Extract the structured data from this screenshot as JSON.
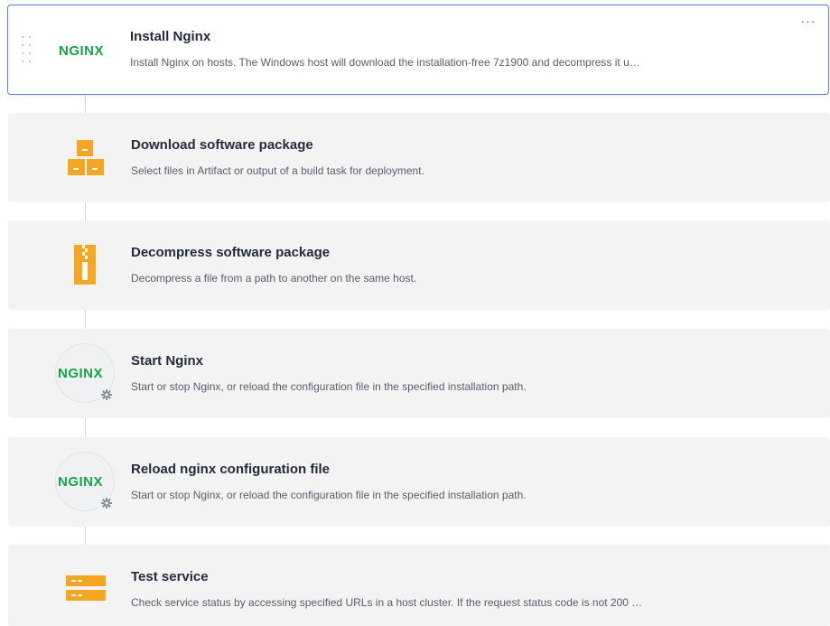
{
  "steps": [
    {
      "title": "Install Nginx",
      "description": "Install Nginx on hosts. The Windows host will download the installation-free 7z1900 and decompress it u…",
      "icon": "nginx-logo-icon",
      "logo_text": "NGINX",
      "selected": true
    },
    {
      "title": "Download software package",
      "description": "Select files in Artifact or output of a build task for deployment.",
      "icon": "package-boxes-icon"
    },
    {
      "title": "Decompress software package",
      "description": "Decompress a file from a path to another on the same host.",
      "icon": "zip-archive-icon"
    },
    {
      "title": "Start Nginx",
      "description": "Start or stop Nginx, or reload the configuration file in the specified installation path.",
      "icon": "nginx-logo-icon",
      "logo_text": "NGINX"
    },
    {
      "title": "Reload nginx configuration file",
      "description": "Start or stop Nginx, or reload the configuration file in the specified installation path.",
      "icon": "nginx-logo-icon",
      "logo_text": "NGINX"
    },
    {
      "title": "Test service",
      "description": "Check service status by accessing specified URLs in a host cluster. If the request status code is not 200 …",
      "icon": "server-rack-icon"
    }
  ],
  "more_label": "···",
  "colors": {
    "accent": "#5e7ce0",
    "nginx_green": "#16a34a",
    "icon_orange": "#f5a623",
    "card_bg": "#f3f3f4"
  }
}
